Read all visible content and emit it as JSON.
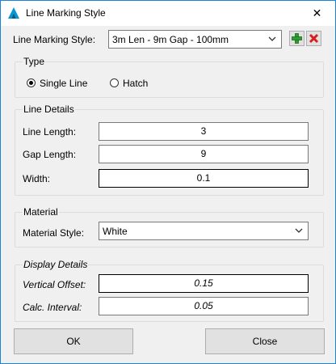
{
  "window": {
    "title": "Line Marking Style",
    "app_icon": "autodesk-logo-icon",
    "close_glyph": "✕"
  },
  "style_row": {
    "label": "Line Marking Style:",
    "selected": "3m Len - 9m Gap - 100mm",
    "add_icon": "green-plus-icon",
    "delete_icon": "red-x-icon"
  },
  "type_group": {
    "title": "Type",
    "options": [
      "Single Line",
      "Hatch"
    ],
    "selected": "Single Line"
  },
  "line_details": {
    "title": "Line Details",
    "line_length_label": "Line Length:",
    "line_length_value": "3",
    "gap_length_label": "Gap Length:",
    "gap_length_value": "9",
    "width_label": "Width:",
    "width_value": "0.1"
  },
  "material": {
    "title": "Material",
    "style_label": "Material Style:",
    "style_value": "White"
  },
  "display_details": {
    "title": "Display Details",
    "vertical_offset_label": "Vertical Offset:",
    "vertical_offset_value": "0.15",
    "calc_interval_label": "Calc. Interval:",
    "calc_interval_value": "0.05"
  },
  "buttons": {
    "ok": "OK",
    "close": "Close"
  },
  "colors": {
    "window_border": "#1883d7",
    "dialog_bg": "#f0f0f0",
    "add_green": "#2e9e2e",
    "delete_red": "#d81e1e"
  }
}
